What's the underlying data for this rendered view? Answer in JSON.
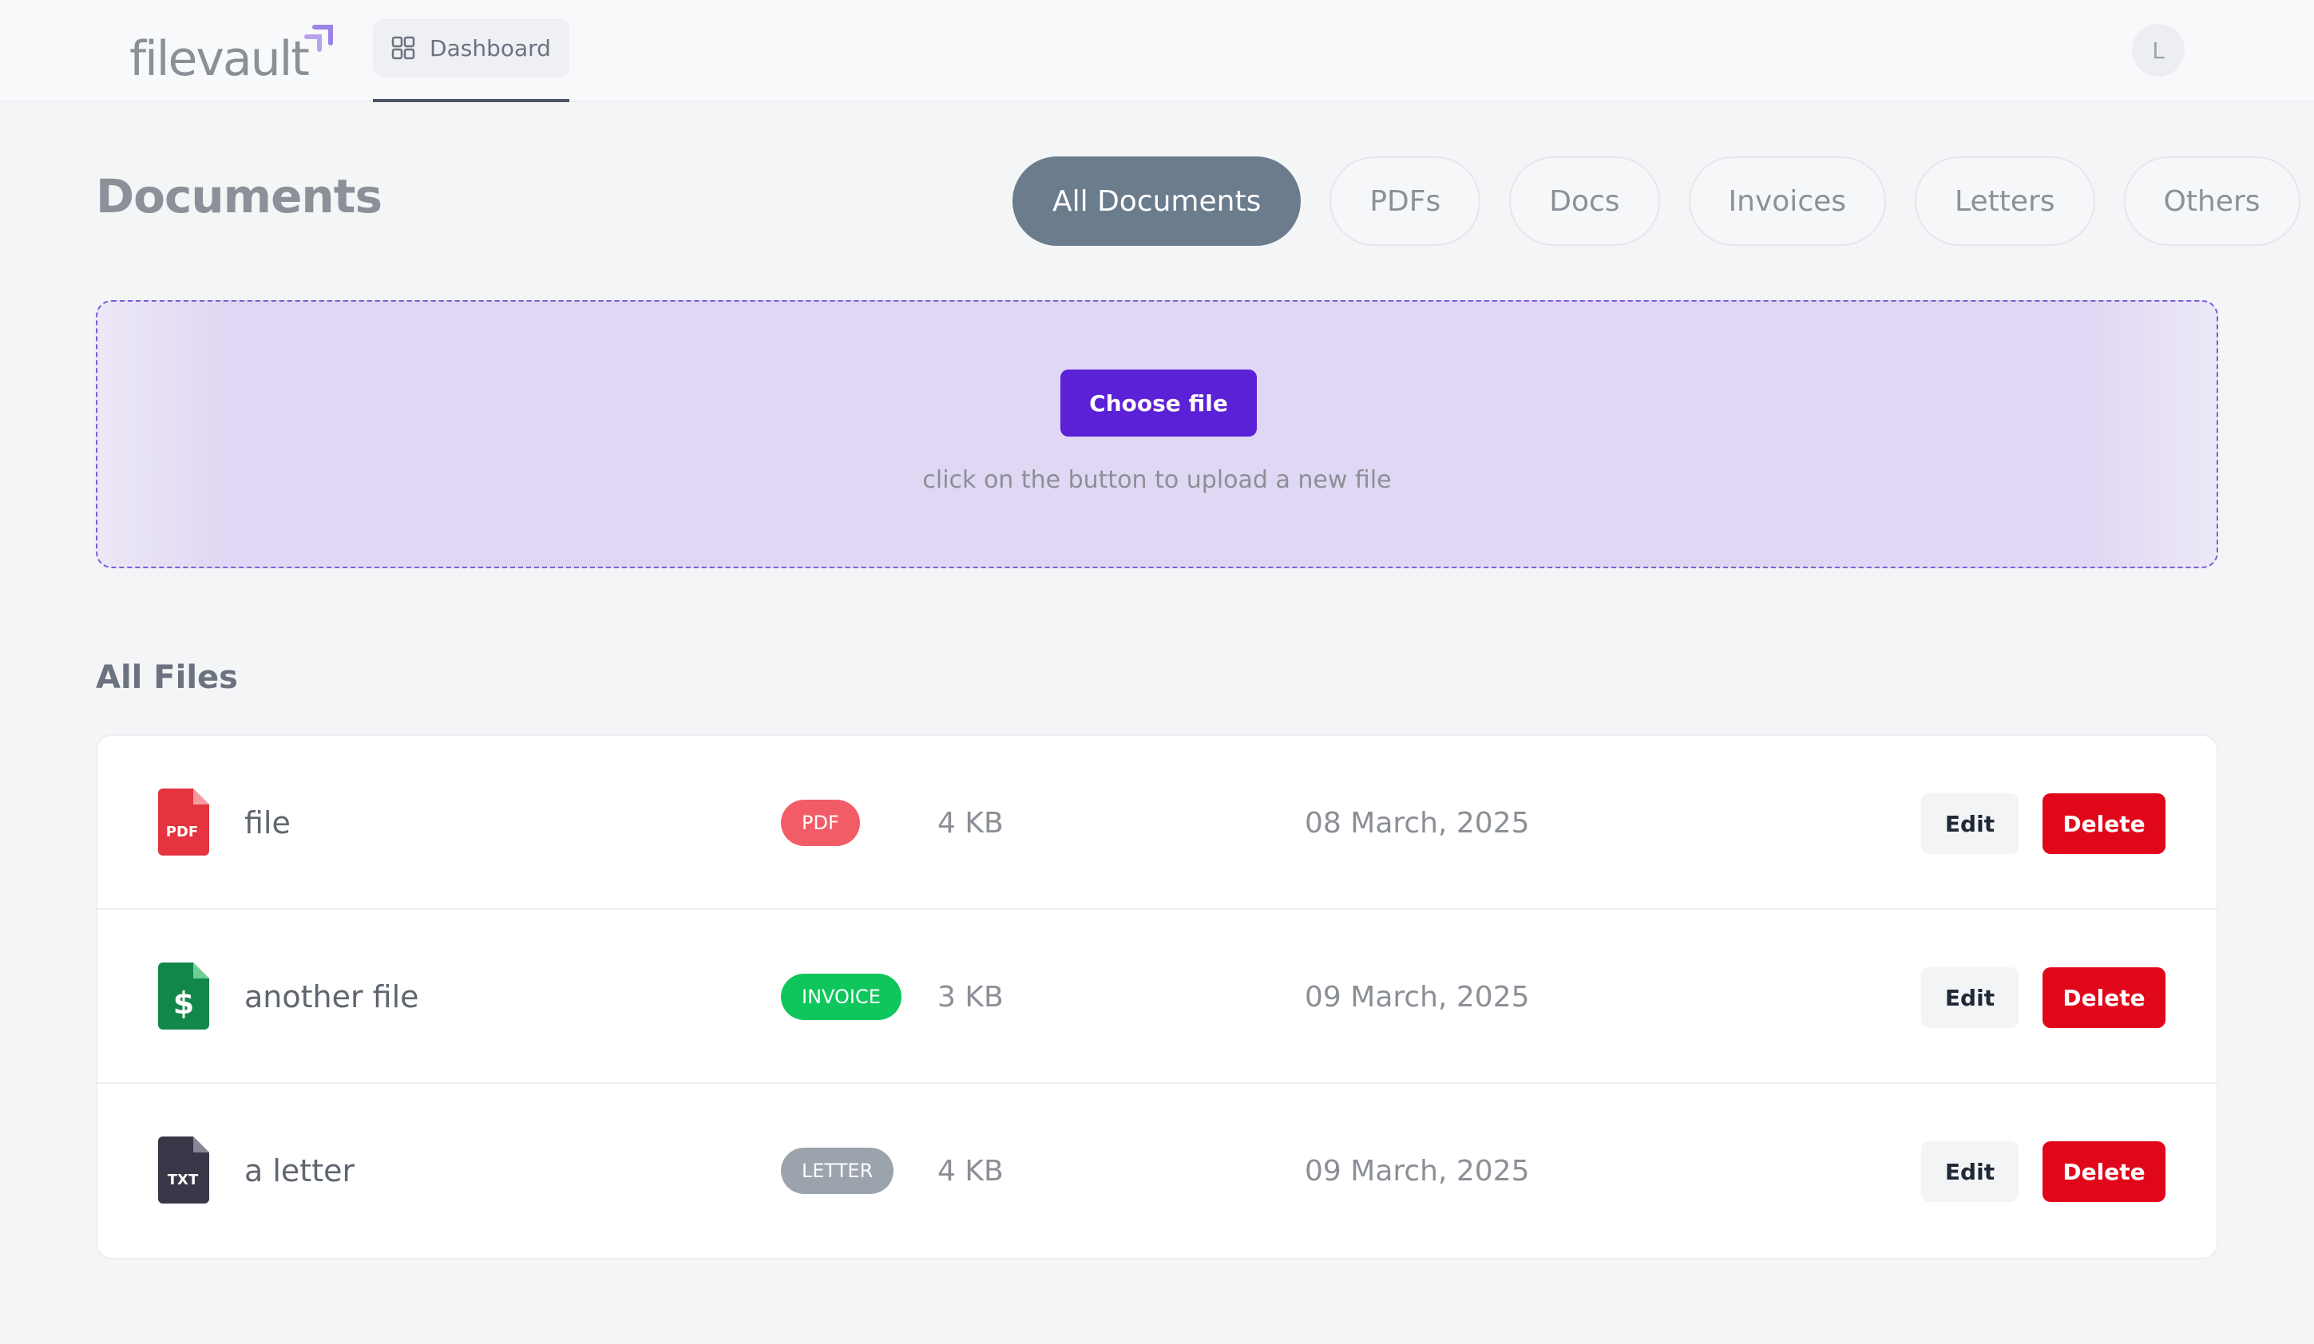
{
  "brand": {
    "name": "filevault"
  },
  "nav": {
    "tab_label": "Dashboard",
    "avatar_initial": "L"
  },
  "page": {
    "title": "Documents"
  },
  "filters": [
    {
      "label": "All Documents",
      "active": true
    },
    {
      "label": "PDFs",
      "active": false
    },
    {
      "label": "Docs",
      "active": false
    },
    {
      "label": "Invoices",
      "active": false
    },
    {
      "label": "Letters",
      "active": false
    },
    {
      "label": "Others",
      "active": false
    }
  ],
  "upload": {
    "button_label": "Choose file",
    "hint": "click on the button to upload a new file"
  },
  "files_section": {
    "title": "All Files"
  },
  "files": [
    {
      "name": "file",
      "type": "PDF",
      "type_color": "#f25c67",
      "icon": "pdf-file-icon",
      "icon_label": "PDF",
      "size": "4 KB",
      "date": "08 March, 2025",
      "edit_label": "Edit",
      "delete_label": "Delete"
    },
    {
      "name": "another file",
      "type": "INVOICE",
      "type_color": "#0fc65c",
      "icon": "invoice-file-icon",
      "icon_label": "$",
      "size": "3 KB",
      "date": "09 March, 2025",
      "edit_label": "Edit",
      "delete_label": "Delete"
    },
    {
      "name": "a letter",
      "type": "LETTER",
      "type_color": "#9ba3ad",
      "icon": "txt-file-icon",
      "icon_label": "TXT",
      "size": "4 KB",
      "date": "09 March, 2025",
      "edit_label": "Edit",
      "delete_label": "Delete"
    }
  ],
  "colors": {
    "accent": "#5b21d6",
    "danger": "#e0071b",
    "active_filter": "#6b7c8c",
    "pdf_icon": "#e5333f",
    "invoice_icon": "#12874a",
    "txt_icon": "#3b3647"
  }
}
